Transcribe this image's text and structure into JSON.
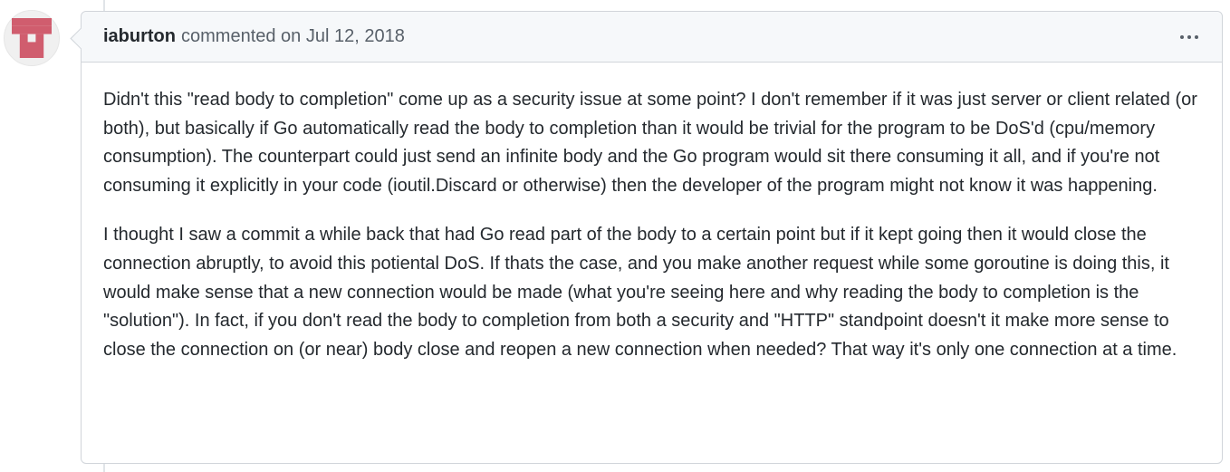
{
  "avatar": {
    "icon": "identicon-avatar",
    "color": "#d05d6e"
  },
  "comment": {
    "author": "iaburton",
    "meta": "commented on Jul 12, 2018",
    "menu_icon": "kebab-horizontal-icon",
    "paragraphs": [
      "Didn't this \"read body to completion\" come up as a security issue at some point? I don't remember if it was just server or client related (or both), but basically if Go automatically read the body to completion than it would be trivial for the program to be DoS'd (cpu/memory consumption). The counterpart could just send an infinite body and the Go program would sit there consuming it all, and if you're not consuming it explicitly in your code (ioutil.Discard or otherwise) then the developer of the program might not know it was happening.",
      "I thought I saw a commit a while back that had Go read part of the body to a certain point but if it kept going then it would close the connection abruptly, to avoid this potiental DoS. If thats the case, and you make another request while some goroutine is doing this, it would make sense that a new connection would be made (what you're seeing here and why reading the body to completion is the \"solution\"). In fact, if you don't read the body to completion from both a security and \"HTTP\" standpoint doesn't it make more sense to close the connection on (or near) body close and reopen a new connection when needed? That way it's only one connection at a time."
    ]
  }
}
